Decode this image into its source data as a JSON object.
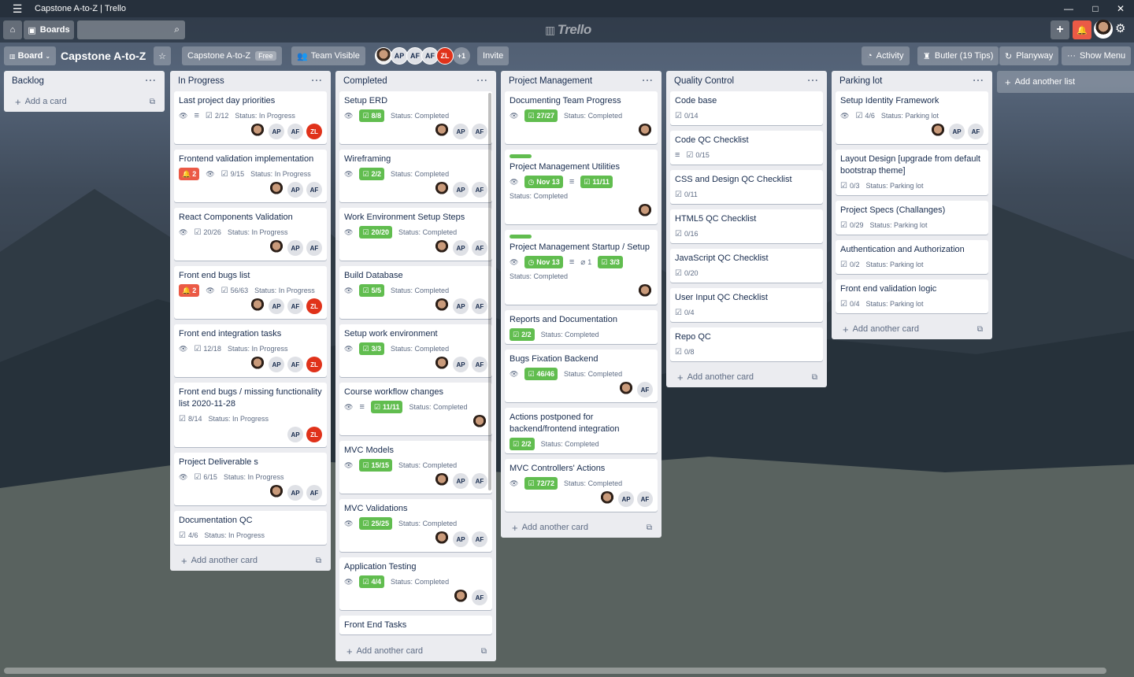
{
  "window": {
    "title": "Capstone A-to-Z | Trello",
    "minimize": "—",
    "maximize": "□",
    "close": "✕"
  },
  "header": {
    "boards_label": "Boards",
    "logo": "Trello",
    "add": "+"
  },
  "boardbar": {
    "board_view": "Board",
    "board_name": "Capstone A-to-Z",
    "team": "Capstone A-to-Z",
    "plan": "Free",
    "visibility": "Team Visible",
    "members": [
      "AP",
      "AF",
      "AF",
      "ZL"
    ],
    "more_members": "+1",
    "invite": "Invite",
    "activity": "Activity",
    "butler": "Butler (19 Tips)",
    "planyway": "Planyway",
    "show_menu": "Show Menu"
  },
  "lists": [
    {
      "title": "Backlog",
      "add_label": "Add a card",
      "cards": []
    },
    {
      "title": "In Progress",
      "add_label": "Add another card",
      "cards": [
        {
          "title": "Last project day priorities",
          "watch": true,
          "desc": true,
          "check": "2/12",
          "status": "Status: In Progress",
          "members": [
            "photo",
            "AP",
            "AF",
            "ZL"
          ]
        },
        {
          "title": "Frontend validation implementation",
          "red": "2",
          "watch": true,
          "check": "9/15",
          "status": "Status: In Progress",
          "members": [
            "photo",
            "AP",
            "AF"
          ]
        },
        {
          "title": "React Components Validation",
          "watch": true,
          "check": "20/26",
          "status": "Status: In Progress",
          "members": [
            "photo",
            "AP",
            "AF"
          ]
        },
        {
          "title": "Front end bugs list",
          "red": "2",
          "watch": true,
          "check": "56/63",
          "status": "Status: In Progress",
          "members": [
            "photo",
            "AP",
            "AF",
            "ZL"
          ]
        },
        {
          "title": "Front end integration tasks",
          "watch": true,
          "check": "12/18",
          "status": "Status: In Progress",
          "members": [
            "photo",
            "AP",
            "AF",
            "ZL"
          ]
        },
        {
          "title": "Front end bugs / missing functionality list 2020-11-28",
          "check": "8/14",
          "status": "Status: In Progress",
          "members": [
            "AP",
            "ZL"
          ]
        },
        {
          "title": "Project Deliverable s",
          "watch": true,
          "check": "6/15",
          "status": "Status: In Progress",
          "members": [
            "photo",
            "AP",
            "AF"
          ]
        },
        {
          "title": "Documentation QC",
          "check": "4/6",
          "status": "Status: In Progress",
          "members": []
        }
      ]
    },
    {
      "title": "Completed",
      "add_label": "Add another card",
      "cards": [
        {
          "title": "Setup ERD",
          "watch": true,
          "green": "8/8",
          "status": "Status: Completed",
          "members": [
            "photo",
            "AP",
            "AF"
          ]
        },
        {
          "title": "Wireframing",
          "watch": true,
          "green": "2/2",
          "status": "Status: Completed",
          "members": [
            "photo",
            "AP",
            "AF"
          ]
        },
        {
          "title": "Work Environment Setup Steps",
          "watch": true,
          "green": "20/20",
          "status": "Status: Completed",
          "members": [
            "photo",
            "AP",
            "AF"
          ]
        },
        {
          "title": "Build Database",
          "watch": true,
          "green": "5/5",
          "status": "Status: Completed",
          "members": [
            "photo",
            "AP",
            "AF"
          ]
        },
        {
          "title": "Setup work environment",
          "watch": true,
          "green": "3/3",
          "status": "Status: Completed",
          "members": [
            "photo",
            "AP",
            "AF"
          ]
        },
        {
          "title": "Course workflow changes",
          "watch": true,
          "desc": true,
          "green": "11/11",
          "status": "Status: Completed",
          "members": [
            "photo"
          ]
        },
        {
          "title": "MVC Models",
          "watch": true,
          "green": "15/15",
          "status": "Status: Completed",
          "members": [
            "photo",
            "AP",
            "AF"
          ]
        },
        {
          "title": "MVC Validations",
          "watch": true,
          "green": "25/25",
          "status": "Status: Completed",
          "members": [
            "photo",
            "AP",
            "AF"
          ]
        },
        {
          "title": "Application Testing",
          "watch": true,
          "green": "4/4",
          "status": "Status: Completed",
          "members": [
            "photo",
            "AF"
          ]
        },
        {
          "title": "Front End Tasks",
          "members": []
        }
      ]
    },
    {
      "title": "Project Management",
      "add_label": "Add another card",
      "cards": [
        {
          "title": "Documenting Team Progress",
          "watch": true,
          "green": "27/27",
          "status": "Status: Completed",
          "members": [
            "photo"
          ]
        },
        {
          "title": "Project Management Utilities",
          "label": true,
          "watch": true,
          "due": "Nov 13",
          "desc": true,
          "green": "11/11",
          "status_line": "Status: Completed",
          "members": [
            "photo"
          ]
        },
        {
          "title": "Project Management Startup / Setup",
          "label": true,
          "watch": true,
          "due": "Nov 13",
          "desc": true,
          "attach": "1",
          "green": "3/3",
          "status_line": "Status: Completed",
          "members": [
            "photo"
          ]
        },
        {
          "title": "Reports and Documentation",
          "green": "2/2",
          "status": "Status: Completed",
          "members": []
        },
        {
          "title": "Bugs Fixation Backend",
          "watch": true,
          "green": "46/46",
          "status": "Status: Completed",
          "members": [
            "photo",
            "AF"
          ]
        },
        {
          "title": "Actions postponed for backend/frontend integration",
          "green": "2/2",
          "status": "Status: Completed",
          "members": []
        },
        {
          "title": "MVC Controllers' Actions",
          "watch": true,
          "green": "72/72",
          "status": "Status: Completed",
          "members": [
            "photo",
            "AP",
            "AF"
          ]
        }
      ]
    },
    {
      "title": "Quality Control",
      "add_label": "Add another card",
      "cards": [
        {
          "title": "Code base",
          "check": "0/14",
          "members": []
        },
        {
          "title": "Code QC Checklist",
          "desc": true,
          "check": "0/15",
          "members": []
        },
        {
          "title": "CSS and Design QC Checklist",
          "check": "0/11",
          "members": []
        },
        {
          "title": "HTML5 QC Checklist",
          "check": "0/16",
          "members": []
        },
        {
          "title": "JavaScript QC Checklist",
          "check": "0/20",
          "members": []
        },
        {
          "title": "User Input QC Checklist",
          "check": "0/4",
          "members": []
        },
        {
          "title": "Repo QC",
          "check": "0/8",
          "members": []
        }
      ]
    },
    {
      "title": "Parking lot",
      "add_label": "Add another card",
      "cards": [
        {
          "title": "Setup Identity Framework",
          "watch": true,
          "check": "4/6",
          "status": "Status: Parking lot",
          "members": [
            "photo",
            "AP",
            "AF"
          ]
        },
        {
          "title": "Layout Design [upgrade from default bootstrap theme]",
          "check": "0/3",
          "status": "Status: Parking lot",
          "members": []
        },
        {
          "title": "Project Specs (Challanges)",
          "check": "0/29",
          "status": "Status: Parking lot",
          "members": []
        },
        {
          "title": "Authentication and Authorization",
          "check": "0/2",
          "status": "Status: Parking lot",
          "members": []
        },
        {
          "title": "Front end validation logic",
          "check": "0/4",
          "status": "Status: Parking lot",
          "members": []
        }
      ]
    }
  ],
  "add_list_label": "Add another list",
  "colors": {
    "green": "#61bd4f",
    "red": "#eb5a46",
    "list_bg": "#ebecf0"
  }
}
